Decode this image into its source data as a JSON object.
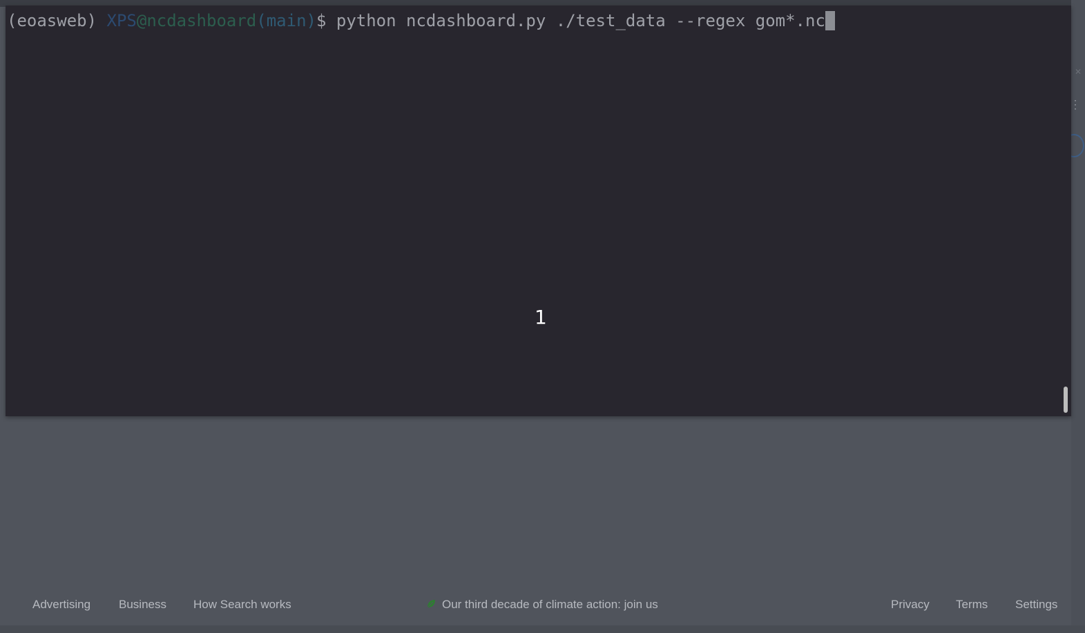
{
  "terminal": {
    "env": "(eoasweb) ",
    "user": "XPS",
    "at": "@",
    "host": "ncdashboard",
    "branch": "(main)",
    "dollar": "$ ",
    "command": "python ncdashboard.py ./test_data --regex gom*.nc",
    "overlay_counter": "1"
  },
  "footer": {
    "left_links": [
      "Advertising",
      "Business",
      "How Search works"
    ],
    "center_text": "Our third decade of climate action: join us",
    "right_links": [
      "Privacy",
      "Terms",
      "Settings"
    ],
    "center_icon": "leaf-icon",
    "leaf_color": "#2e7d32"
  },
  "colors": {
    "terminal_bg": "#28262e",
    "page_bg": "#50545c"
  }
}
